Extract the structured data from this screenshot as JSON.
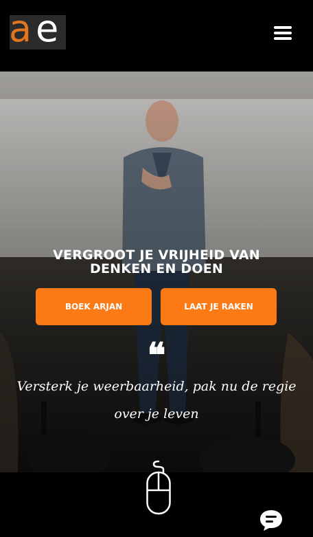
{
  "header": {
    "logo": {
      "letter_a": "a",
      "letter_e": "e"
    },
    "menu_icon": "hamburger-menu-icon"
  },
  "hero": {
    "title": "VERGROOT JE VRIJHEID VAN DENKEN EN DOEN",
    "buttons": [
      {
        "label": "BOEK ARJAN"
      },
      {
        "label": "LAAT JE RAKEN"
      }
    ],
    "quote_mark": "❝",
    "quote": "Versterk je weerbaarheid, pak nu de regie over je leven"
  },
  "footer": {
    "scroll_icon": "mouse-scroll-icon",
    "chat_icon": "chat-bubble-icon"
  },
  "colors": {
    "accent": "#fb7a15",
    "logo_orange": "#e2751f",
    "background": "#000000"
  }
}
